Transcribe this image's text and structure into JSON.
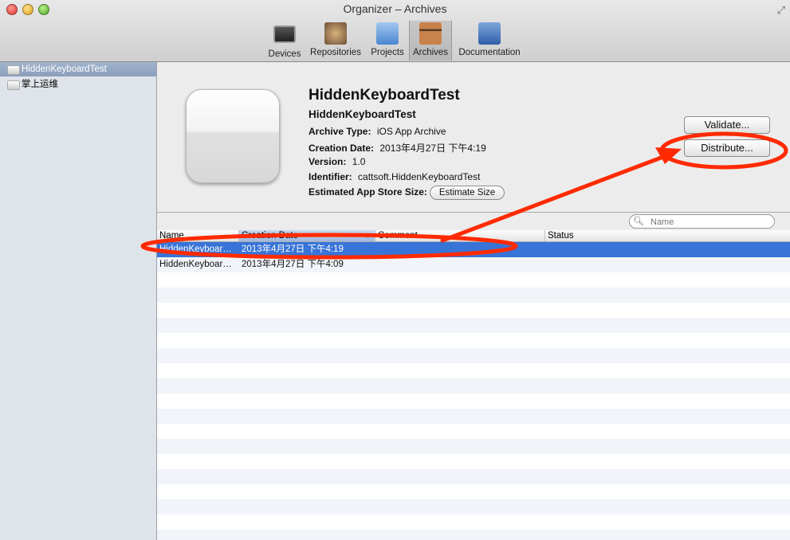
{
  "window": {
    "title": "Organizer – Archives"
  },
  "toolbar": {
    "items": [
      {
        "label": "Devices",
        "icon": "devices-icon"
      },
      {
        "label": "Repositories",
        "icon": "repositories-icon"
      },
      {
        "label": "Projects",
        "icon": "projects-icon"
      },
      {
        "label": "Archives",
        "icon": "archives-icon"
      },
      {
        "label": "Documentation",
        "icon": "documentation-icon"
      }
    ]
  },
  "sidebar": {
    "items": [
      {
        "label": "HiddenKeyboardTest"
      },
      {
        "label": "掌上运维"
      }
    ]
  },
  "detail": {
    "app_name": "HiddenKeyboardTest",
    "sub_name": "HiddenKeyboardTest",
    "archive_type_label": "Archive Type:",
    "archive_type_value": "iOS App Archive",
    "creation_date_label": "Creation Date:",
    "creation_date_value": "2013年4月27日 下午4:19",
    "version_label": "Version:",
    "version_value": "1.0",
    "identifier_label": "Identifier:",
    "identifier_value": "cattsoft.HiddenKeyboardTest",
    "size_label": "Estimated App Store Size:",
    "estimate_button": "Estimate Size",
    "validate_button": "Validate...",
    "distribute_button": "Distribute..."
  },
  "search": {
    "placeholder": "Name"
  },
  "table": {
    "columns": [
      "Name",
      "Creation Date",
      "Comment",
      "Status"
    ],
    "rows": [
      {
        "name": "HiddenKeyboar…",
        "date": "2013年4月27日 下午4:19",
        "comment": "",
        "status": ""
      },
      {
        "name": "HiddenKeyboar…",
        "date": "2013年4月27日 下午4:09",
        "comment": "",
        "status": ""
      }
    ]
  },
  "colors": {
    "selection": "#3874d8",
    "annotation": "#ff2a00"
  }
}
